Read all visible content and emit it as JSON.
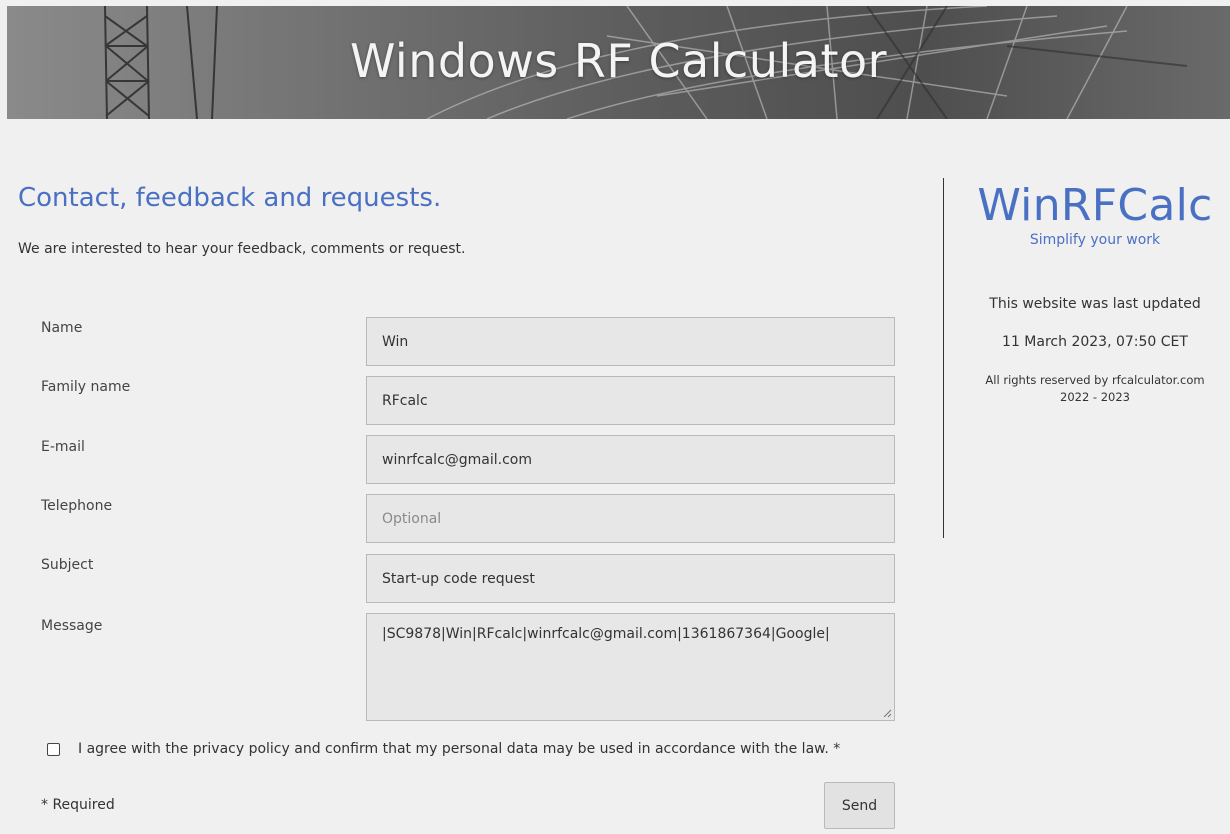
{
  "header": {
    "title": "Windows RF Calculator"
  },
  "contact": {
    "title": "Contact, feedback and requests.",
    "intro": "We are interested to hear your feedback, comments or request."
  },
  "form": {
    "name": {
      "label": "Name",
      "value": "Win"
    },
    "family_name": {
      "label": "Family name",
      "value": "RFcalc"
    },
    "email": {
      "label": "E-mail",
      "value": "winrfcalc@gmail.com"
    },
    "telephone": {
      "label": "Telephone",
      "value": "",
      "placeholder": "Optional"
    },
    "subject": {
      "label": "Subject",
      "value": "Start-up code request"
    },
    "message": {
      "label": "Message",
      "value": "|SC9878|Win|RFcalc|winrfcalc@gmail.com|1361867364|Google|"
    },
    "agree_label": "I agree with the privacy policy and confirm that my personal data may be used in accordance with the law. *",
    "agree_checked": false,
    "required_note": "* Required",
    "send_label": "Send"
  },
  "sidebar": {
    "brand": "WinRFCalc",
    "tagline": "Simplify your work",
    "updated_label": "This website was last updated",
    "updated_date": "11 March 2023, 07:50 CET",
    "rights": "All rights reserved by rfcalculator.com",
    "years": "2022 - 2023"
  },
  "colors": {
    "accent": "#4a70c4",
    "background": "#f0f0f0",
    "field_bg": "#e7e7e7"
  },
  "icons": {
    "resize": "resize-handle-icon",
    "banner": "radio-tower-image"
  }
}
